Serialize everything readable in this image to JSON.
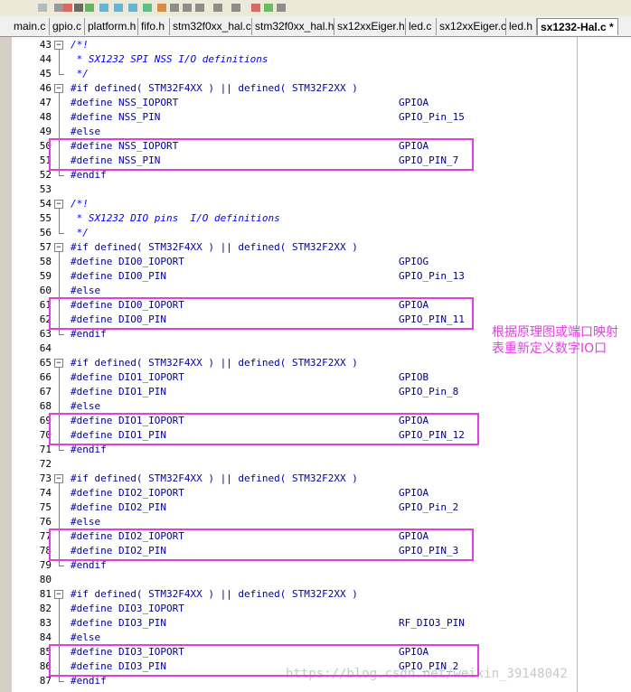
{
  "tabs": [
    {
      "label": "main.c",
      "active": false
    },
    {
      "label": "gpio.c",
      "active": false
    },
    {
      "label": "platform.h",
      "active": false
    },
    {
      "label": "fifo.h",
      "active": false
    },
    {
      "label": "stm32f0xx_hal.c",
      "active": false
    },
    {
      "label": "stm32f0xx_hal.h",
      "active": false
    },
    {
      "label": "sx12xxEiger.h",
      "active": false
    },
    {
      "label": "led.c",
      "active": false
    },
    {
      "label": "sx12xxEiger.c",
      "active": false
    },
    {
      "label": "led.h",
      "active": false
    },
    {
      "label": "sx1232-Hal.c *",
      "active": true
    }
  ],
  "lines": [
    {
      "n": "43",
      "text": "/*!",
      "kind": "cmt",
      "value": ""
    },
    {
      "n": "44",
      "text": " * SX1232 SPI NSS I/O definitions",
      "kind": "cmt",
      "value": ""
    },
    {
      "n": "45",
      "text": " */",
      "kind": "cmt",
      "value": ""
    },
    {
      "n": "46",
      "text": "#if defined( STM32F4XX ) || defined( STM32F2XX )",
      "kind": "pp",
      "value": ""
    },
    {
      "n": "47",
      "text": "#define NSS_IOPORT",
      "kind": "pp",
      "value": "GPIOA"
    },
    {
      "n": "48",
      "text": "#define NSS_PIN",
      "kind": "pp",
      "value": "GPIO_Pin_15"
    },
    {
      "n": "49",
      "text": "#else",
      "kind": "pp",
      "value": ""
    },
    {
      "n": "50",
      "text": "#define NSS_IOPORT",
      "kind": "pp",
      "value": "GPIOA"
    },
    {
      "n": "51",
      "text": "#define NSS_PIN",
      "kind": "pp",
      "value": "GPIO_PIN_7"
    },
    {
      "n": "52",
      "text": "#endif",
      "kind": "pp",
      "value": ""
    },
    {
      "n": "53",
      "text": "",
      "kind": "pp",
      "value": ""
    },
    {
      "n": "54",
      "text": "/*!",
      "kind": "cmt",
      "value": ""
    },
    {
      "n": "55",
      "text": " * SX1232 DIO pins  I/O definitions",
      "kind": "cmt",
      "value": ""
    },
    {
      "n": "56",
      "text": " */",
      "kind": "cmt",
      "value": ""
    },
    {
      "n": "57",
      "text": "#if defined( STM32F4XX ) || defined( STM32F2XX )",
      "kind": "pp",
      "value": ""
    },
    {
      "n": "58",
      "text": "#define DIO0_IOPORT",
      "kind": "pp",
      "value": "GPIOG"
    },
    {
      "n": "59",
      "text": "#define DIO0_PIN",
      "kind": "pp",
      "value": "GPIO_Pin_13"
    },
    {
      "n": "60",
      "text": "#else",
      "kind": "pp",
      "value": ""
    },
    {
      "n": "61",
      "text": "#define DIO0_IOPORT",
      "kind": "pp",
      "value": "GPIOA"
    },
    {
      "n": "62",
      "text": "#define DIO0_PIN",
      "kind": "pp",
      "value": "GPIO_PIN_11"
    },
    {
      "n": "63",
      "text": "#endif",
      "kind": "pp",
      "value": ""
    },
    {
      "n": "64",
      "text": "",
      "kind": "pp",
      "value": ""
    },
    {
      "n": "65",
      "text": "#if defined( STM32F4XX ) || defined( STM32F2XX )",
      "kind": "pp",
      "value": ""
    },
    {
      "n": "66",
      "text": "#define DIO1_IOPORT",
      "kind": "pp",
      "value": "GPIOB"
    },
    {
      "n": "67",
      "text": "#define DIO1_PIN",
      "kind": "pp",
      "value": "GPIO_Pin_8"
    },
    {
      "n": "68",
      "text": "#else",
      "kind": "pp",
      "value": ""
    },
    {
      "n": "69",
      "text": "#define DIO1_IOPORT",
      "kind": "pp",
      "value": "GPIOA"
    },
    {
      "n": "70",
      "text": "#define DIO1_PIN",
      "kind": "pp",
      "value": "GPIO_PIN_12"
    },
    {
      "n": "71",
      "text": "#endif",
      "kind": "pp",
      "value": ""
    },
    {
      "n": "72",
      "text": "",
      "kind": "pp",
      "value": ""
    },
    {
      "n": "73",
      "text": "#if defined( STM32F4XX ) || defined( STM32F2XX )",
      "kind": "pp",
      "value": ""
    },
    {
      "n": "74",
      "text": "#define DIO2_IOPORT",
      "kind": "pp",
      "value": "GPIOA"
    },
    {
      "n": "75",
      "text": "#define DIO2_PIN",
      "kind": "pp",
      "value": "GPIO_Pin_2"
    },
    {
      "n": "76",
      "text": "#else",
      "kind": "pp",
      "value": ""
    },
    {
      "n": "77",
      "text": "#define DIO2_IOPORT",
      "kind": "pp",
      "value": "GPIOA"
    },
    {
      "n": "78",
      "text": "#define DIO2_PIN",
      "kind": "pp",
      "value": "GPIO_PIN_3"
    },
    {
      "n": "79",
      "text": "#endif",
      "kind": "pp",
      "value": ""
    },
    {
      "n": "80",
      "text": "",
      "kind": "pp",
      "value": ""
    },
    {
      "n": "81",
      "text": "#if defined( STM32F4XX ) || defined( STM32F2XX )",
      "kind": "pp",
      "value": ""
    },
    {
      "n": "82",
      "text": "#define DIO3_IOPORT",
      "kind": "pp",
      "value": ""
    },
    {
      "n": "83",
      "text": "#define DIO3_PIN",
      "kind": "pp",
      "value": "RF_DIO3_PIN"
    },
    {
      "n": "84",
      "text": "#else",
      "kind": "pp",
      "value": ""
    },
    {
      "n": "85",
      "text": "#define DIO3_IOPORT",
      "kind": "pp",
      "value": "GPIOA"
    },
    {
      "n": "86",
      "text": "#define DIO3_PIN",
      "kind": "pp",
      "value": "GPIO_PIN_2"
    },
    {
      "n": "87",
      "text": "#endif",
      "kind": "pp",
      "value": ""
    }
  ],
  "note": "根据原理图或端口映射表重新定义数字IO口",
  "watermark": "https://blog.csdn.net/weixin_39148042",
  "colors": {
    "highlight": "#e040e0",
    "comment": "#0000ff",
    "code": "#000080"
  },
  "toolbar_icons": [
    "check-icon",
    "cursor-icon",
    "target-icon",
    "dropdown-arrow-icon",
    "forward-icon",
    "back-icon",
    "step-icon",
    "step-out-icon",
    "run-icon",
    "debug-icon",
    "window-icon",
    "gear-icon",
    "copy-icon",
    "grid-icon",
    "view-icon",
    "breakpoint-icon",
    "play-icon",
    "zoom-icon"
  ]
}
